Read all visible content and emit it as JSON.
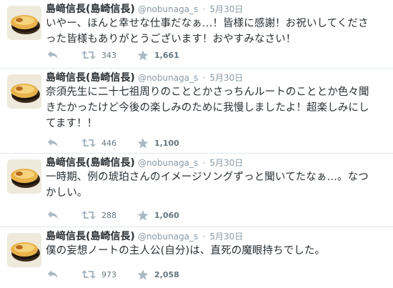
{
  "colors": {
    "icon_gray": "#aab8c2",
    "name": "#292f33",
    "meta": "#8899a6"
  },
  "tweets": [
    {
      "name": "島﨑信長(島崎信長)",
      "handle": "@nobunaga_s",
      "separator": "·",
      "time": "5月30日",
      "lines": [
        "いやー、ほんと幸せな仕事だなぁ…！皆様に感謝！お祝いしてくださ",
        "った皆様もありがとうございます！おやすみなさい！"
      ],
      "retweets": "343",
      "favorites": "1,661"
    },
    {
      "name": "島﨑信長(島崎信長)",
      "handle": "@nobunaga_s",
      "separator": "·",
      "time": "5月30日",
      "lines": [
        "奈須先生に二十七祖周りのこととかさっちんルートのこととか色々聞",
        "きたかったけど今後の楽しみのために我慢しましたよ！超楽しみにし",
        "てます！！"
      ],
      "retweets": "446",
      "favorites": "1,100"
    },
    {
      "name": "島﨑信長(島崎信長)",
      "handle": "@nobunaga_s",
      "separator": "·",
      "time": "5月30日",
      "lines": [
        "一時期、例の琥珀さんのイメージソングずっと聞いてたなぁ…。なつ",
        "かしい。"
      ],
      "retweets": "288",
      "favorites": "1,060"
    },
    {
      "name": "島﨑信長(島崎信長)",
      "handle": "@nobunaga_s",
      "separator": "·",
      "time": "5月30日",
      "lines": [
        "僕の妄想ノートの主人公(自分)は、直死の魔眼持ちでした。"
      ],
      "retweets": "973",
      "favorites": "2,058"
    }
  ]
}
